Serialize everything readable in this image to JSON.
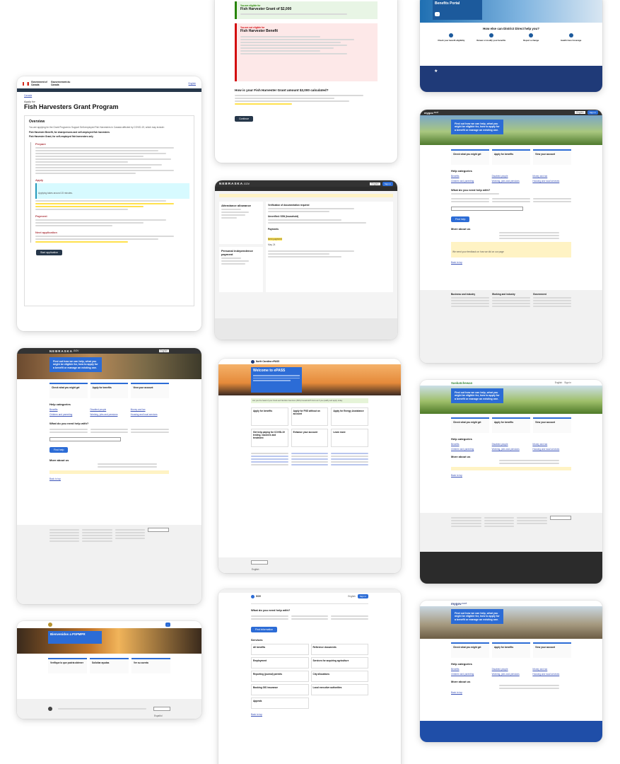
{
  "canada": {
    "gov_en": "Government of Canada",
    "gov_fr": "Gouvernement du Canada",
    "lang": "English",
    "crumb": "Canada",
    "apply_for": "Apply for",
    "title": "Fish Harvesters Grant Program",
    "overview": "Overview",
    "overview_text": "You are applying for the Grant Program to Support Self-employed Fish Harvesters in Canada affected by COVID-19, which may include:",
    "bullet1": "Fish Harvester Benefit, for sharepersons and self-employed fish harvesters",
    "bullet2": "Fish Harvester Grant, for self-employed fish harvesters only",
    "step1": "Prepare",
    "step2": "Apply",
    "step2_note": "Applying takes around 15 minutes.",
    "step3": "Payment",
    "step4": "Next application",
    "start": "Start application"
  },
  "eligibility": {
    "eligible": "You are eligible for",
    "grant": "Fish Harvester Grant of $2,000",
    "not_eligible": "You are not eligible for",
    "benefit": "Fish Harvester Benefit",
    "question": "How is your Fish Harvester Grant amount $2,000 calculated?",
    "continue": "Continue"
  },
  "district": {
    "portal": "Benefits Portal",
    "help": "How else can District Direct help you?",
    "tiles": [
      "Check your benefit eligibility",
      "Renew or modify your benefits",
      "Report a change",
      "Health Care Coverage"
    ]
  },
  "nebraska1": {
    "logo": "NEBRASKA",
    "gov": ".GOV",
    "lang": "English",
    "signin": "Sign in",
    "card1": "Attendance allowance",
    "card2": "Personal independence payment",
    "verify": "Verification of documentation required",
    "unverified": "Unverified: SSN (household)",
    "payments": "Payments",
    "next_pay": "Next payment",
    "date": "May 24"
  },
  "mygov": {
    "logo": "mygov",
    "scot": ".scot",
    "lang": "English",
    "signin": "Sign in",
    "hero": "Find out how we can help, what you might be eligible for, how to apply for a benefit or manage an existing one.",
    "check": "Check what you might get",
    "apply": "Apply for benefits",
    "account": "View your account",
    "help": "Help categories",
    "cats": [
      "Benefits",
      "Disabled people",
      "Money and tax",
      "Children and parenting",
      "Working, jobs and pensions",
      "Housing and local services"
    ],
    "need": "What do you need help with?",
    "find": "Find help",
    "more": "More about us",
    "feedback": "We need your feedback on how we did on our page",
    "back": "Back to top",
    "footer_cols": [
      "Business and industry",
      "Working and industry",
      "Government"
    ]
  },
  "nebraska2": {
    "logo": "NEBRASKA",
    "gov": ".GOV",
    "hero": "Find out how we can help, what you might be eligible for, how to apply for a benefit or manage an existing one.",
    "check": "Check what you might get",
    "apply": "Apply for benefits",
    "account": "View your account",
    "help": "Help categories",
    "cats": [
      "Benefits",
      "Disabled people",
      "Money and tax",
      "Children and parenting",
      "Working, jobs and pensions",
      "Housing and local services"
    ],
    "need": "What do you need help with?",
    "find": "Find help",
    "more": "More about us",
    "back": "Back to top",
    "lang": "English"
  },
  "northcarolina": {
    "brand": "North Carolina ePASS",
    "welcome": "Welcome to ePASS",
    "alert": "Are you the head of your Food and Nutrition Services (FNS) household? Find out if you qualify and apply today.",
    "tiles": [
      "Apply for benefits",
      "Apply for FNS without an account",
      "Apply for Energy Assistance",
      "Get help paying for COVID-19 testing, vaccines and treatment",
      "Enhance your account",
      "Learn more"
    ],
    "lang": "English"
  },
  "saskatchewan": {
    "brand": "Saskatchewan",
    "lang": "English",
    "signin": "Sign in",
    "hero": "Find out how we can help, what you might be eligible for, how to apply for a benefit or manage an existing one.",
    "check": "Check what you might get",
    "apply": "Apply for benefits",
    "account": "View your account",
    "help": "Help categories",
    "cats": [
      "Benefits",
      "Disabled people",
      "Money and tax",
      "Children and parenting",
      "Working, jobs and pensions",
      "Housing and local services"
    ],
    "more": "More about us",
    "back": "Back to top"
  },
  "pspmpr": {
    "hero": "Bienvenidos a PSPMPR",
    "tiles": [
      "Verifique lo que podría obtener",
      "Solicitar ayudas",
      "Ver su cuenta"
    ],
    "lang": "Español"
  },
  "gov": {
    "logo": "GOV",
    "lang": "English",
    "signin": "Sign in",
    "need": "What do you need help with?",
    "find": "Find information",
    "services": "Services",
    "items": [
      "All benefits",
      "Reference documents",
      "Employment",
      "Services for acquiring agriculture",
      "Reporting (journal) permits",
      "City allocations",
      "Booking GIS insurance",
      "Local executive authorities",
      "Appeals"
    ],
    "back": "Back to top"
  },
  "mygov2": {
    "logo": "mygov",
    "scot": ".scot",
    "hero": "Find out how we can help, what you might be eligible for, how to apply for a benefit or manage an existing one.",
    "check": "Check what you might get",
    "apply": "Apply for benefits",
    "account": "View your account",
    "help": "Help categories",
    "cats": [
      "Benefits",
      "Disabled people",
      "Money and tax",
      "Children and parenting",
      "Working, jobs and pensions",
      "Housing and local services"
    ],
    "more": "More about us",
    "back": "Back to top"
  },
  "colors": {
    "accent": "#2c6cd6",
    "gov_red": "#af3c43",
    "canada_navy": "#26374a",
    "nebraska_dark": "#333333",
    "highlight": "#ffe14d",
    "green_note": "#e8f5e5",
    "red_note": "#fde8e8"
  }
}
